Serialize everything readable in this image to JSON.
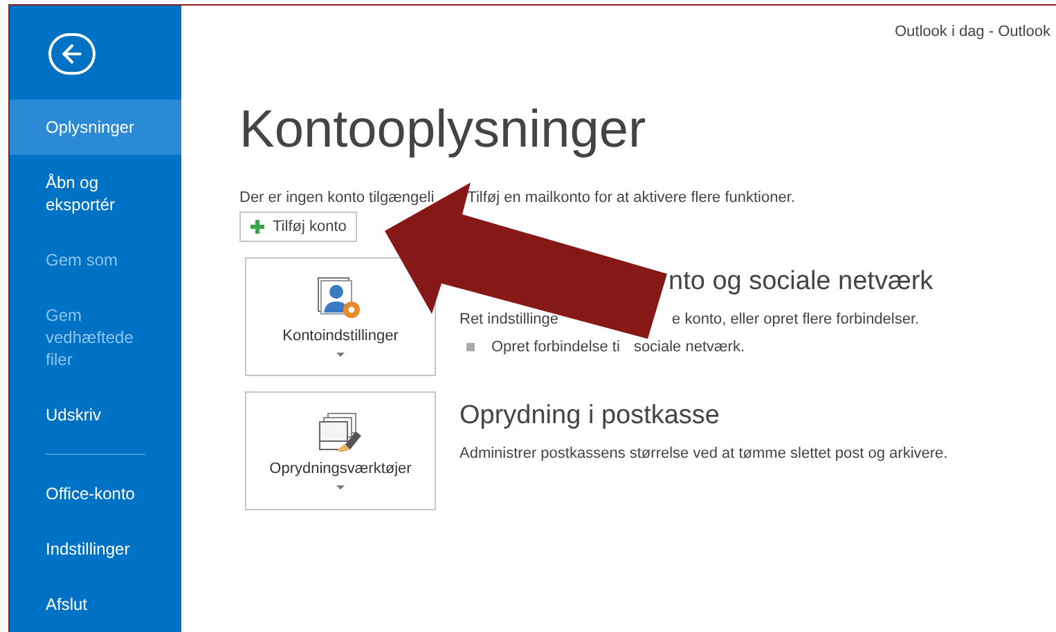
{
  "window": {
    "title": "Outlook i dag - Outlook"
  },
  "sidebar": {
    "items": [
      {
        "kind": "item",
        "label": "Oplysninger",
        "selected": true,
        "disabled": false
      },
      {
        "kind": "item",
        "label": "Åbn og eksportér",
        "selected": false,
        "disabled": false
      },
      {
        "kind": "item",
        "label": "Gem som",
        "selected": false,
        "disabled": true
      },
      {
        "kind": "item",
        "label": "Gem vedhæftede filer",
        "selected": false,
        "disabled": true
      },
      {
        "kind": "item",
        "label": "Udskriv",
        "selected": false,
        "disabled": false
      },
      {
        "kind": "divider"
      },
      {
        "kind": "item",
        "label": "Office-konto",
        "selected": false,
        "disabled": false
      },
      {
        "kind": "item",
        "label": "Indstillinger",
        "selected": false,
        "disabled": false
      },
      {
        "kind": "item",
        "label": "Afslut",
        "selected": false,
        "disabled": false
      }
    ]
  },
  "main": {
    "heading": "Kontooplysninger",
    "notice": [
      "Der er ingen konto tilgængeli",
      "Tilføj en mailkonto for at aktivere flere funktioner."
    ],
    "add_button": {
      "label": "Tilføj konto"
    },
    "sections": [
      {
        "kind": "account",
        "button_label": "Kontoindstillinger",
        "heading": [
          "nto og sociale netværk"
        ],
        "description": [
          "Ret indstillinge",
          "e konto, eller opret flere forbindelser."
        ],
        "bullets": [
          [
            "Opret forbindelse ti",
            "sociale netværk."
          ]
        ]
      },
      {
        "kind": "cleanup",
        "button_label": "Oprydningsværktøjer",
        "heading": [
          "Oprydning i postkasse"
        ],
        "description": [
          "Administrer postkassens størrelse ved at tømme slettet post og arkivere."
        ]
      }
    ]
  }
}
